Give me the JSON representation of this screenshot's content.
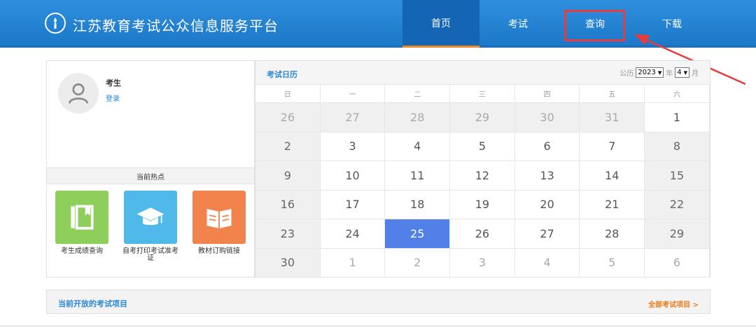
{
  "header": {
    "title": "江苏教育考试公众信息服务平台",
    "logo_icon": "torch-emblem-icon",
    "nav": [
      "首页",
      "考试",
      "查询",
      "下载"
    ],
    "active_nav": 0,
    "highlighted_nav": 2
  },
  "user": {
    "name": "考生",
    "login_label": "登录"
  },
  "hot": {
    "title": "当前热点",
    "items": [
      {
        "label": "考生成绩查询",
        "icon": "notebook-icon",
        "color": "#8ecf5c"
      },
      {
        "label": "自考打印考试准考证",
        "icon": "graduation-cap-icon",
        "color": "#4fb9ea"
      },
      {
        "label": "教材订购链接",
        "icon": "open-book-icon",
        "color": "#f3834d"
      }
    ]
  },
  "calendar": {
    "title": "考试日历",
    "calendar_label": "公历",
    "year": "2023",
    "year_label": "年",
    "month": "4",
    "month_label": "月",
    "weekdays": [
      "日",
      "一",
      "二",
      "三",
      "四",
      "五",
      "六"
    ],
    "today": "25",
    "weeks": [
      [
        "26",
        "27",
        "28",
        "29",
        "30",
        "31",
        "1"
      ],
      [
        "2",
        "3",
        "4",
        "5",
        "6",
        "7",
        "8"
      ],
      [
        "9",
        "10",
        "11",
        "12",
        "13",
        "14",
        "15"
      ],
      [
        "16",
        "17",
        "18",
        "19",
        "20",
        "21",
        "22"
      ],
      [
        "23",
        "24",
        "25",
        "26",
        "27",
        "28",
        "29"
      ],
      [
        "30",
        "1",
        "2",
        "3",
        "4",
        "5",
        "6"
      ]
    ]
  },
  "bottom": {
    "title": "当前开放的考试项目",
    "link": "全部考试项目 >"
  },
  "colors": {
    "header": "#1c78c8",
    "accent": "#f08a24",
    "highlight": "#e83b3b",
    "today": "#5180e9"
  }
}
